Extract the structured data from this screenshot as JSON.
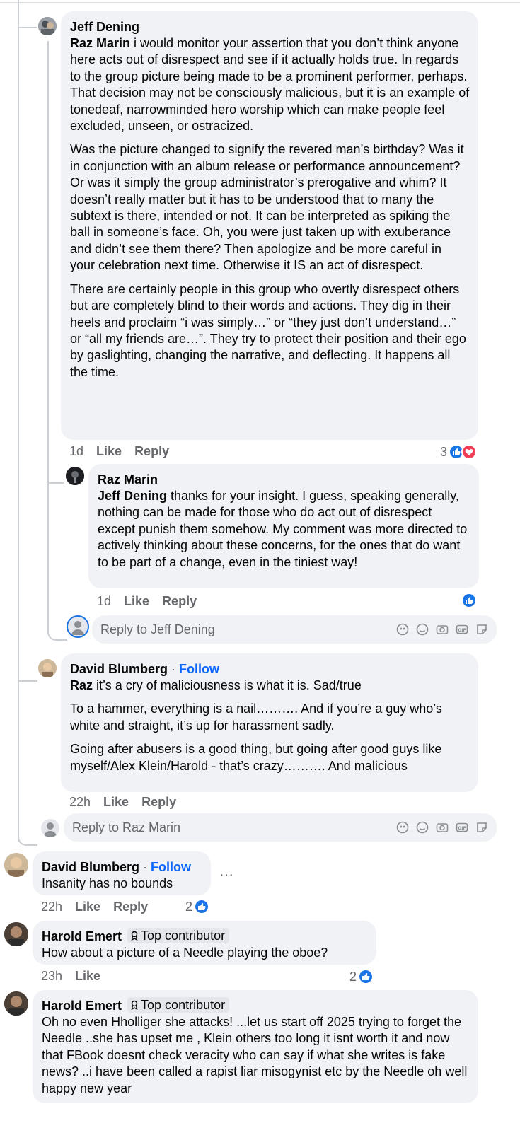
{
  "comments": {
    "jeff": {
      "author": "Jeff Dening",
      "mention": "Raz Marin",
      "p1_rest": " i would monitor your assertion that you don’t think anyone here acts out of disrespect and see if it actually holds true. In regards to the group picture being made to be a prominent performer, perhaps. That decision may not be consciously malicious, but it is an example of tonedeaf, narrowminded hero worship which can make people feel excluded, unseen, or ostracized.",
      "p2": "Was the picture changed to signify the revered man’s birthday? Was it in conjunction with an album release or performance announcement? Or was it simply the group administrator’s prerogative and whim? It doesn’t really matter but it has to be understood that to many the subtext is there, intended or not. It can be interpreted as spiking the ball in someone’s face. Oh, you were just taken up with exuberance and didn’t see them there? Then apologize and be more careful in your celebration next time. Otherwise it IS an act of disrespect.",
      "p3": "There are certainly people in this group who overtly disrespect others but are completely blind to their words and actions. They dig in their heels and proclaim “i was simply…” or “they just don’t understand…” or “all my friends are…”. They try to protect their position and their ego by gaslighting, changing the narrative, and deflecting. It happens all the time.",
      "time": "1d",
      "like": "Like",
      "reply": "Reply",
      "reaction_count": "3"
    },
    "raz": {
      "author": "Raz Marin",
      "mention": "Jeff Dening",
      "text_rest": " thanks for your insight. I guess, speaking generally, nothing can be made for those who do act out of disrespect except punish them somehow. My comment was more directed to actively thinking about these concerns, for the ones that do want to be part of a change, even in the tiniest way!",
      "time": "1d",
      "like": "Like",
      "reply": "Reply"
    },
    "reply_box_1": {
      "placeholder": "Reply to Jeff Dening"
    },
    "david1": {
      "author": "David Blumberg",
      "dot": " · ",
      "follow": "Follow",
      "mention": "Raz",
      "p1_rest": " it’s a cry of maliciousness is what it is. Sad/true",
      "p2": "To a hammer, everything is a nail………. And if you’re a guy who’s white and straight, it’s up for harassment sadly.",
      "p3": "Going after abusers is a good thing, but going after good guys like myself/Alex Klein/Harold - that’s crazy………. And malicious",
      "time": "22h",
      "like": "Like",
      "reply": "Reply"
    },
    "reply_box_2": {
      "placeholder": "Reply to Raz Marin"
    },
    "david2": {
      "author": "David Blumberg",
      "dot": " · ",
      "follow": "Follow",
      "text": "Insanity has no bounds",
      "time": "22h",
      "like": "Like",
      "reply": "Reply",
      "reaction_count": "2",
      "more": "···"
    },
    "harold1": {
      "author": "Harold Emert",
      "badge": "Top contributor",
      "text": "How about a picture of a Needle playing the oboe?",
      "time": "23h",
      "like": "Like",
      "reaction_count": "2"
    },
    "harold2": {
      "author": "Harold Emert",
      "badge": "Top contributor",
      "text": "Oh no even Hholliger she attacks! ...let us start off 2025 trying to forget the Needle ..she has upset me , Klein others too long it isnt worth it and now that FBook doesnt check veracity who can say if what she writes is fake news? ..i have been called a rapist liar misogynist etc by the Needle oh well happy new year"
    }
  },
  "colors": {
    "link": "#0866ff",
    "like": "#1b74e4",
    "love": "#f33e58",
    "bubble": "#f0f2f5",
    "meta": "#65676b"
  }
}
